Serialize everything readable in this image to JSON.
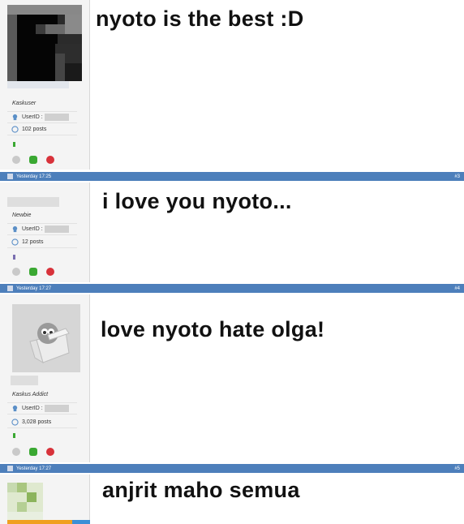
{
  "posts": [
    {
      "message": "nyoto is the best :D",
      "rank": "Kaskuser",
      "userid_label": "UserID :",
      "post_count": "102 posts",
      "rep_color": "#3aa832"
    },
    {
      "message": "i love you nyoto...",
      "rank": "Newbie",
      "userid_label": "UserID :",
      "post_count": "12 posts",
      "rep_color": "#7a6fb0"
    },
    {
      "message": "love nyoto hate olga!",
      "rank": "Kaskus Addict",
      "userid_label": "UserID :",
      "post_count": "3,028 posts",
      "rep_color": "#3aa832"
    },
    {
      "message": "anjrit maho semua"
    }
  ],
  "bars": [
    {
      "timestamp": "Yesterday 17:25",
      "number": "#3"
    },
    {
      "timestamp": "Yesterday 17:27",
      "number": "#4"
    },
    {
      "timestamp": "Yesterday 17:27",
      "number": "#5"
    }
  ],
  "icons": {
    "userid": "user-icon",
    "posts": "speech-bubble-icon",
    "actions": [
      "smiley-icon",
      "quote-icon",
      "report-icon"
    ]
  },
  "colors": {
    "bar": "#4d7fbb",
    "accent_green": "#3aa832",
    "accent_red": "#d8323a"
  }
}
